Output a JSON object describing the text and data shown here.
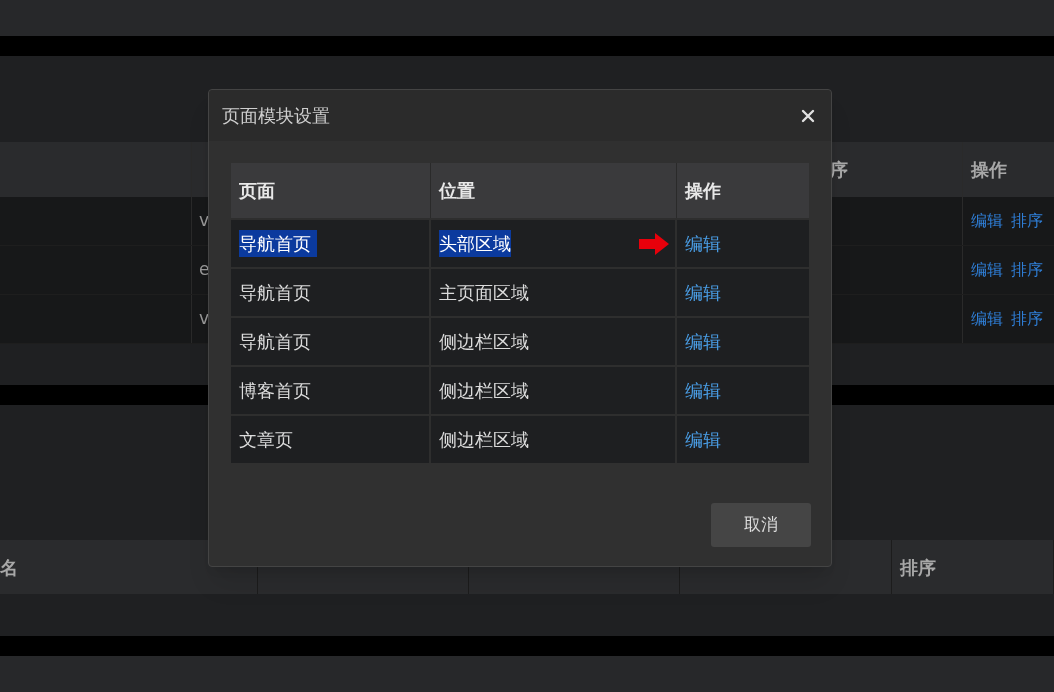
{
  "background": {
    "top_table": {
      "header": [
        "序",
        "操作"
      ],
      "rows": [
        {
          "column_2": "v",
          "actions": [
            "编辑",
            "排序"
          ]
        },
        {
          "column_2": "e",
          "actions": [
            "编辑",
            "排序"
          ]
        },
        {
          "column_2": "v",
          "actions": [
            "编辑",
            "排序"
          ]
        }
      ]
    },
    "bottom_table": {
      "first_header": "名",
      "last_header": "排序"
    }
  },
  "dialog": {
    "title": "页面模块设置",
    "columns": [
      "页面",
      "位置",
      "操作"
    ],
    "rows": [
      {
        "page": "导航首页",
        "position": "头部区域",
        "action": "编辑",
        "selected": true
      },
      {
        "page": "导航首页",
        "position": "主页面区域",
        "action": "编辑",
        "selected": false
      },
      {
        "page": "导航首页",
        "position": "侧边栏区域",
        "action": "编辑",
        "selected": false
      },
      {
        "page": "博客首页",
        "position": "侧边栏区域",
        "action": "编辑",
        "selected": false
      },
      {
        "page": "文章页",
        "position": "侧边栏区域",
        "action": "编辑",
        "selected": false
      }
    ],
    "buttons": [
      "取消"
    ]
  }
}
